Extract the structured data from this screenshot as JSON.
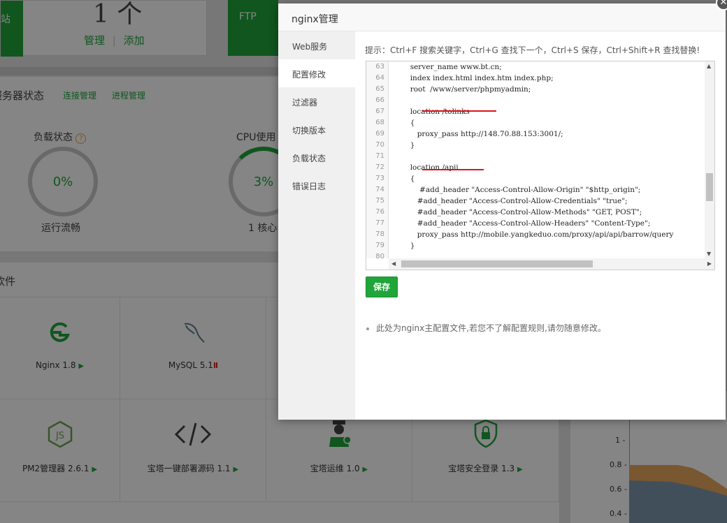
{
  "dashboard": {
    "site_tile_label": "网站",
    "site_count": "1 个",
    "site_manage": "管理",
    "site_divider": "|",
    "site_add": "添加",
    "ftp_label": "FTP",
    "server_status_title": "服务器状态",
    "conn_manage": "连接管理",
    "proc_manage": "进程管理",
    "load_title": "负载状态",
    "load_value": "0%",
    "load_status": "运行流畅",
    "cpu_title": "CPU使用",
    "cpu_value": "3%",
    "cpu_cores": "1 核心",
    "software_title": "软件",
    "software": [
      {
        "name": "Nginx 1.8",
        "icon": "nginx-icon",
        "state": "running"
      },
      {
        "name": "MySQL 5.1",
        "icon": "mysql-icon",
        "state": "stopped"
      },
      {
        "name": "PM2管理器 2.6.1",
        "icon": "nodejs-icon",
        "state": "running"
      },
      {
        "name": "宝塔一键部署源码 1.1",
        "icon": "code-icon",
        "state": "running"
      },
      {
        "name": "宝塔运维 1.0",
        "icon": "ops-icon",
        "state": "running"
      },
      {
        "name": "宝塔安全登录 1.3",
        "icon": "shield-lock-icon",
        "state": "running"
      }
    ],
    "chart_ticks": [
      "1 -",
      "0.8 -",
      "0.6 -",
      "0.4 -"
    ]
  },
  "modal": {
    "title": "nginx管理",
    "close": "✕",
    "menu": [
      "Web服务",
      "配置修改",
      "过滤器",
      "切换版本",
      "负载状态",
      "错误日志"
    ],
    "active_menu": "配置修改",
    "tip": "提示：Ctrl+F 搜索关键字，Ctrl+G 查找下一个，Ctrl+S 保存，Ctrl+Shift+R 查找替换!",
    "save_label": "保存",
    "note": "此处为nginx主配置文件,若您不了解配置规则,请勿随意修改。",
    "code": [
      {
        "n": "63",
        "t": "        server_name www.bt.cn;"
      },
      {
        "n": "64",
        "t": "        index index.html index.htm index.php;"
      },
      {
        "n": "65",
        "t": "        root  /www/server/phpmyadmin;"
      },
      {
        "n": "66",
        "t": ""
      },
      {
        "n": "67",
        "t": "        location /tolinks"
      },
      {
        "n": "68",
        "t": "        {"
      },
      {
        "n": "69",
        "t": "           proxy_pass http://148.70.88.153:3001/;"
      },
      {
        "n": "70",
        "t": "        }"
      },
      {
        "n": "71",
        "t": ""
      },
      {
        "n": "72",
        "t": "        location /apii"
      },
      {
        "n": "73",
        "t": "        {"
      },
      {
        "n": "74",
        "t": "            #add_header \"Access-Control-Allow-Origin\" \"$http_origin\";"
      },
      {
        "n": "75",
        "t": "           #add_header \"Access-Control-Allow-Credentials\" \"true\";"
      },
      {
        "n": "76",
        "t": "           #add_header \"Access-Control-Allow-Methods\" \"GET, POST\";"
      },
      {
        "n": "77",
        "t": "           #add_header \"Access-Control-Allow-Headers\" \"Content-Type\";"
      },
      {
        "n": "78",
        "t": "           proxy_pass http://mobile.yangkeduo.com/proxy/api/api/barrow/query"
      },
      {
        "n": "79",
        "t": "        }"
      },
      {
        "n": "80",
        "t": ""
      }
    ]
  }
}
